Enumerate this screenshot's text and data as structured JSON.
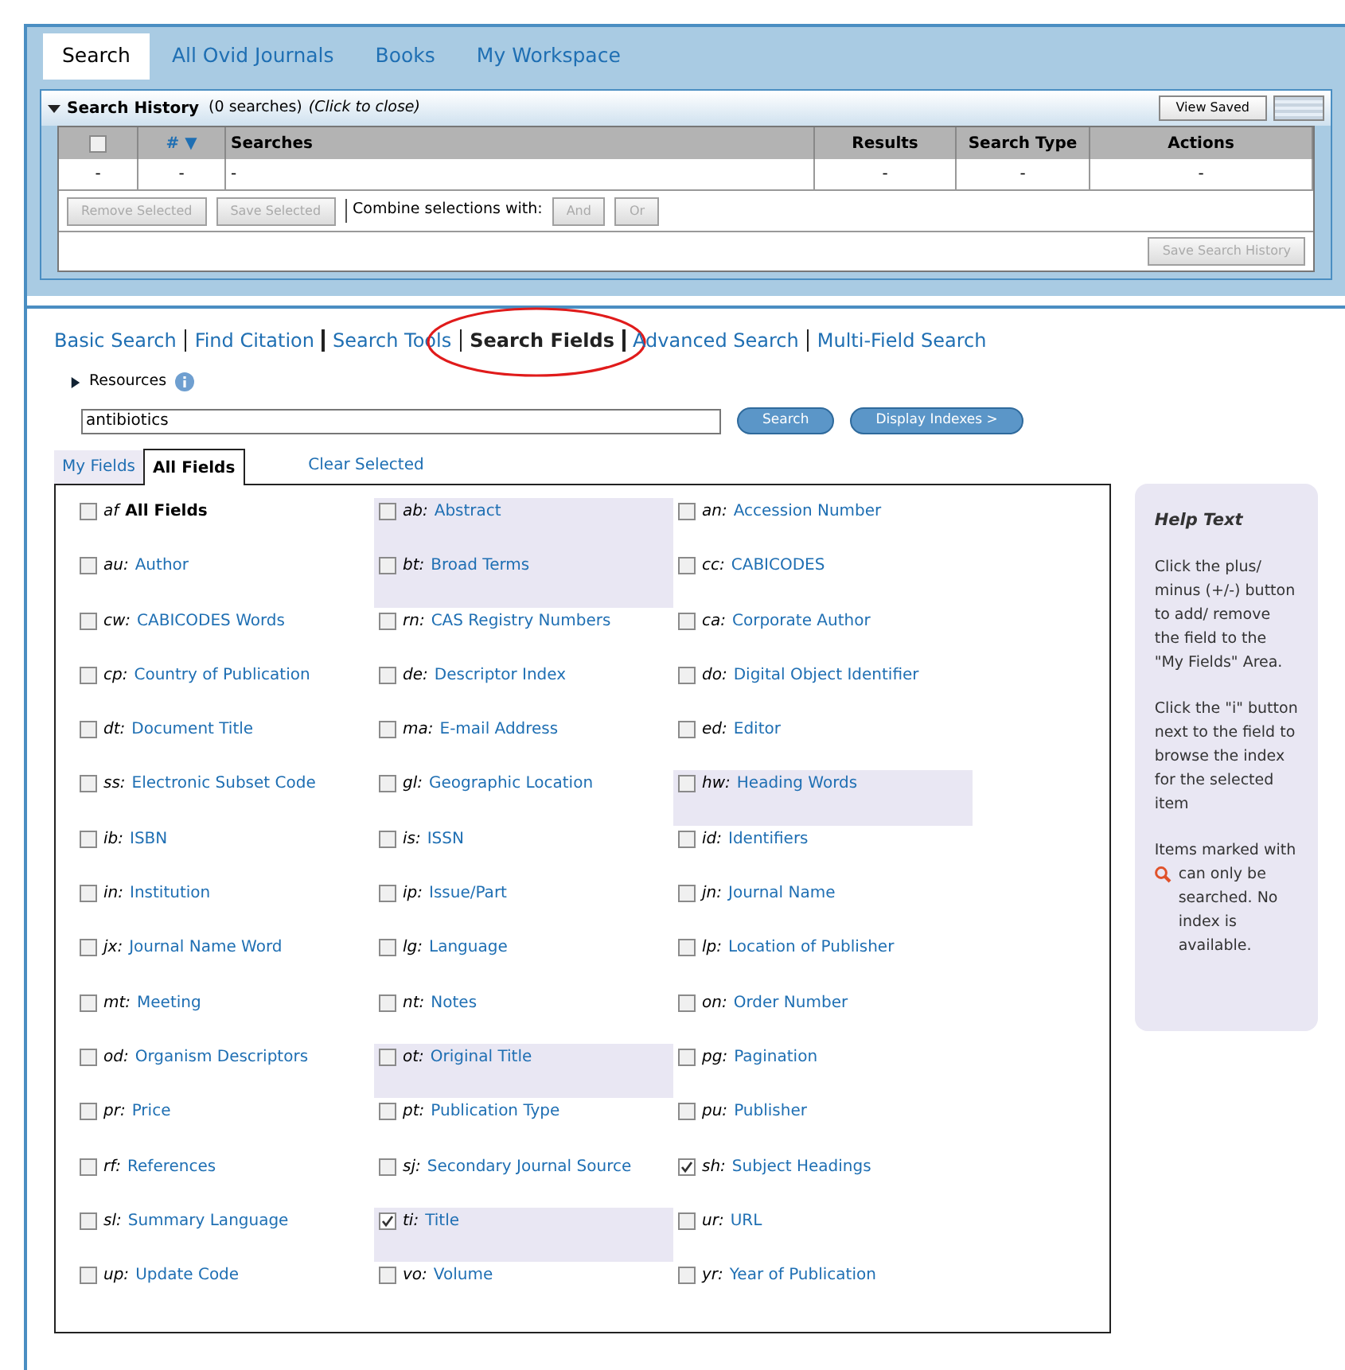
{
  "tabs": [
    {
      "label": "Search",
      "selected": true
    },
    {
      "label": "All Ovid Journals",
      "selected": false
    },
    {
      "label": "Books",
      "selected": false
    },
    {
      "label": "My Workspace",
      "selected": false
    }
  ],
  "search_history": {
    "expanded": true,
    "title": "Search History",
    "count": "(0 searches)",
    "hint": "(Click to close)",
    "view_saved": "View Saved",
    "columns": [
      {
        "kind": "checkbox",
        "checked": false
      },
      {
        "kind": "sort",
        "label": "# ▼"
      },
      {
        "kind": "text",
        "label": "Searches"
      },
      {
        "kind": "text",
        "label": "Results"
      },
      {
        "kind": "text",
        "label": "Search Type"
      },
      {
        "kind": "text",
        "label": "Actions"
      }
    ],
    "rows": [
      [
        "-",
        "-",
        "-",
        "-",
        "-",
        "-"
      ]
    ],
    "actions": [
      {
        "label": "Remove Selected",
        "disabled": true
      },
      {
        "label": "Save Selected",
        "disabled": true
      }
    ],
    "combine_label": "Combine selections with:",
    "combine_buttons": [
      {
        "label": "And",
        "disabled": true
      },
      {
        "label": "Or",
        "disabled": true
      }
    ],
    "save_history": {
      "label": "Save Search History",
      "disabled": true
    }
  },
  "search_modes": [
    {
      "label": "Basic Search",
      "selected": false,
      "circled": false
    },
    {
      "label": "Find Citation",
      "selected": false,
      "circled": false
    },
    {
      "label": "Search Tools",
      "selected": false,
      "circled": false
    },
    {
      "label": "Search Fields",
      "selected": true,
      "circled": true
    },
    {
      "label": "Advanced Search",
      "selected": false,
      "circled": false
    },
    {
      "label": "Multi-Field Search",
      "selected": false,
      "circled": false
    }
  ],
  "resources": {
    "label": "Resources",
    "expanded": false
  },
  "query": {
    "value": "antibiotics"
  },
  "search_button": "Search",
  "display_indexes": "Display Indexes >",
  "field_tabs": [
    {
      "label": "My Fields",
      "selected": false
    },
    {
      "label": "All Fields",
      "selected": true
    }
  ],
  "clear_selected": "Clear Selected",
  "fields": [
    {
      "kind": "all",
      "code": "af",
      "label": "All Fields",
      "checked": false,
      "highlighted": false
    },
    {
      "kind": "field",
      "code": "ab:",
      "label": "Abstract",
      "checked": false,
      "highlighted": true
    },
    {
      "kind": "field",
      "code": "an:",
      "label": "Accession Number",
      "checked": false,
      "highlighted": false
    },
    {
      "kind": "field",
      "code": "au:",
      "label": "Author",
      "checked": false,
      "highlighted": false
    },
    {
      "kind": "field",
      "code": "bt:",
      "label": "Broad Terms",
      "checked": false,
      "highlighted": true
    },
    {
      "kind": "field",
      "code": "cc:",
      "label": "CABICODES",
      "checked": false,
      "highlighted": false
    },
    {
      "kind": "field",
      "code": "cw:",
      "label": "CABICODES Words",
      "checked": false,
      "highlighted": false
    },
    {
      "kind": "field",
      "code": "rn:",
      "label": "CAS Registry Numbers",
      "checked": false,
      "highlighted": false
    },
    {
      "kind": "field",
      "code": "ca:",
      "label": "Corporate Author",
      "checked": false,
      "highlighted": false
    },
    {
      "kind": "field",
      "code": "cp:",
      "label": "Country of Publication",
      "checked": false,
      "highlighted": false
    },
    {
      "kind": "field",
      "code": "de:",
      "label": "Descriptor Index",
      "checked": false,
      "highlighted": false
    },
    {
      "kind": "field",
      "code": "do:",
      "label": "Digital Object Identifier",
      "checked": false,
      "highlighted": false
    },
    {
      "kind": "field",
      "code": "dt:",
      "label": "Document Title",
      "checked": false,
      "highlighted": false
    },
    {
      "kind": "field",
      "code": "ma:",
      "label": "E-mail Address",
      "checked": false,
      "highlighted": false
    },
    {
      "kind": "field",
      "code": "ed:",
      "label": "Editor",
      "checked": false,
      "highlighted": false
    },
    {
      "kind": "field",
      "code": "ss:",
      "label": "Electronic Subset Code",
      "checked": false,
      "highlighted": false
    },
    {
      "kind": "field",
      "code": "gl:",
      "label": "Geographic Location",
      "checked": false,
      "highlighted": false
    },
    {
      "kind": "field",
      "code": "hw:",
      "label": "Heading Words",
      "checked": false,
      "highlighted": true
    },
    {
      "kind": "field",
      "code": "ib:",
      "label": "ISBN",
      "checked": false,
      "highlighted": false
    },
    {
      "kind": "field",
      "code": "is:",
      "label": "ISSN",
      "checked": false,
      "highlighted": false
    },
    {
      "kind": "field",
      "code": "id:",
      "label": "Identifiers",
      "checked": false,
      "highlighted": false
    },
    {
      "kind": "field",
      "code": "in:",
      "label": "Institution",
      "checked": false,
      "highlighted": false
    },
    {
      "kind": "field",
      "code": "ip:",
      "label": "Issue/Part",
      "checked": false,
      "highlighted": false
    },
    {
      "kind": "field",
      "code": "jn:",
      "label": "Journal Name",
      "checked": false,
      "highlighted": false
    },
    {
      "kind": "field",
      "code": "jx:",
      "label": "Journal Name Word",
      "checked": false,
      "highlighted": false
    },
    {
      "kind": "field",
      "code": "lg:",
      "label": "Language",
      "checked": false,
      "highlighted": false
    },
    {
      "kind": "field",
      "code": "lp:",
      "label": "Location of Publisher",
      "checked": false,
      "highlighted": false
    },
    {
      "kind": "field",
      "code": "mt:",
      "label": "Meeting",
      "checked": false,
      "highlighted": false
    },
    {
      "kind": "field",
      "code": "nt:",
      "label": "Notes",
      "checked": false,
      "highlighted": false
    },
    {
      "kind": "field",
      "code": "on:",
      "label": "Order Number",
      "checked": false,
      "highlighted": false
    },
    {
      "kind": "field",
      "code": "od:",
      "label": "Organism Descriptors",
      "checked": false,
      "highlighted": false
    },
    {
      "kind": "field",
      "code": "ot:",
      "label": "Original Title",
      "checked": false,
      "highlighted": true
    },
    {
      "kind": "field",
      "code": "pg:",
      "label": "Pagination",
      "checked": false,
      "highlighted": false
    },
    {
      "kind": "field",
      "code": "pr:",
      "label": "Price",
      "checked": false,
      "highlighted": false
    },
    {
      "kind": "field",
      "code": "pt:",
      "label": "Publication Type",
      "checked": false,
      "highlighted": false
    },
    {
      "kind": "field",
      "code": "pu:",
      "label": "Publisher",
      "checked": false,
      "highlighted": false
    },
    {
      "kind": "field",
      "code": "rf:",
      "label": "References",
      "checked": false,
      "highlighted": false
    },
    {
      "kind": "field",
      "code": "sj:",
      "label": "Secondary Journal Source",
      "checked": false,
      "highlighted": false
    },
    {
      "kind": "field",
      "code": "sh:",
      "label": "Subject Headings",
      "checked": true,
      "highlighted": false
    },
    {
      "kind": "field",
      "code": "sl:",
      "label": "Summary Language",
      "checked": false,
      "highlighted": false
    },
    {
      "kind": "field",
      "code": "ti:",
      "label": "Title",
      "checked": true,
      "highlighted": true
    },
    {
      "kind": "field",
      "code": "ur:",
      "label": "URL",
      "checked": false,
      "highlighted": false
    },
    {
      "kind": "field",
      "code": "up:",
      "label": "Update Code",
      "checked": false,
      "highlighted": false
    },
    {
      "kind": "field",
      "code": "vo:",
      "label": "Volume",
      "checked": false,
      "highlighted": false
    },
    {
      "kind": "field",
      "code": "yr:",
      "label": "Year of Publication",
      "checked": false,
      "highlighted": false
    }
  ],
  "help": {
    "title": "Help Text",
    "paragraphs": [
      "Click the plus/ minus (+/-) button to add/ remove the field to the \"My Fields\" Area.",
      "Click the \"i\" button next to the field to browse the index for the selected item"
    ],
    "note_before": "Items marked with",
    "note_after": "can only be searched. No index is available."
  }
}
